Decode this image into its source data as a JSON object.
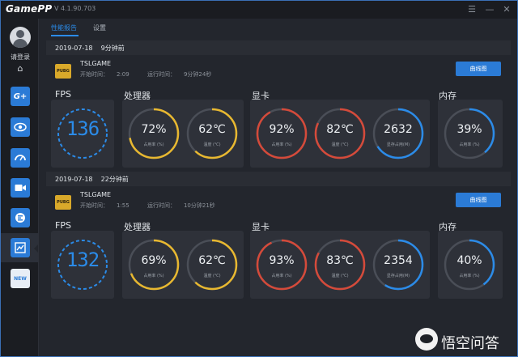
{
  "app": {
    "logo": "GamePP",
    "version": "V 4.1.90.703"
  },
  "window": {
    "minimize_label": "☰",
    "close_label": "—"
  },
  "sidebar": {
    "login_label": "请登录",
    "home_icon": "home-icon",
    "items": [
      {
        "icon": "g-plus-icon",
        "label": "G+"
      },
      {
        "icon": "eye-icon",
        "label": ""
      },
      {
        "icon": "speedometer-icon",
        "label": ""
      },
      {
        "icon": "video-camera-icon",
        "label": ""
      },
      {
        "icon": "boost-icon",
        "label": ""
      },
      {
        "icon": "chart-report-icon",
        "label": ""
      },
      {
        "icon": "new-badge-icon",
        "label": "NEW"
      }
    ]
  },
  "tabs": [
    {
      "label": "性能报告",
      "active": true
    },
    {
      "label": "设置",
      "active": false
    }
  ],
  "labels": {
    "start_prefix": "开始时间：",
    "run_prefix": "运行时间：",
    "curve_button": "曲线图",
    "fps": "FPS",
    "cpu": "处理器",
    "gpu": "显卡",
    "memory": "内存",
    "usage": "占用率 (%)",
    "temp": "温度 (℃)",
    "vram": "显存占用(M)",
    "game_icon_text": "PUBG"
  },
  "colors": {
    "accent_blue": "#2b8be8",
    "cpu_yellow": "#e8b830",
    "gpu_red": "#d54a3a",
    "track": "#4a4e57"
  },
  "sessions": [
    {
      "date": "2019-07-18",
      "ago": "9分钟前",
      "game": "TSLGAME",
      "start_time": "2:09",
      "run_time": "9分钟24秒",
      "fps": "136",
      "cpu_usage": {
        "text": "72%",
        "fraction": 0.72
      },
      "cpu_temp": {
        "text": "62℃",
        "fraction": 0.62
      },
      "gpu_usage": {
        "text": "92%",
        "fraction": 0.92
      },
      "gpu_temp": {
        "text": "82℃",
        "fraction": 0.82
      },
      "vram": {
        "text": "2632",
        "fraction": 0.66
      },
      "mem": {
        "text": "39%",
        "fraction": 0.39
      }
    },
    {
      "date": "2019-07-18",
      "ago": "22分钟前",
      "game": "TSLGAME",
      "start_time": "1:55",
      "run_time": "10分钟21秒",
      "fps": "132",
      "cpu_usage": {
        "text": "69%",
        "fraction": 0.69
      },
      "cpu_temp": {
        "text": "62℃",
        "fraction": 0.62
      },
      "gpu_usage": {
        "text": "93%",
        "fraction": 0.93
      },
      "gpu_temp": {
        "text": "83℃",
        "fraction": 0.83
      },
      "vram": {
        "text": "2354",
        "fraction": 0.59
      },
      "mem": {
        "text": "40%",
        "fraction": 0.4
      }
    }
  ],
  "watermark": {
    "text": "悟空问答"
  }
}
